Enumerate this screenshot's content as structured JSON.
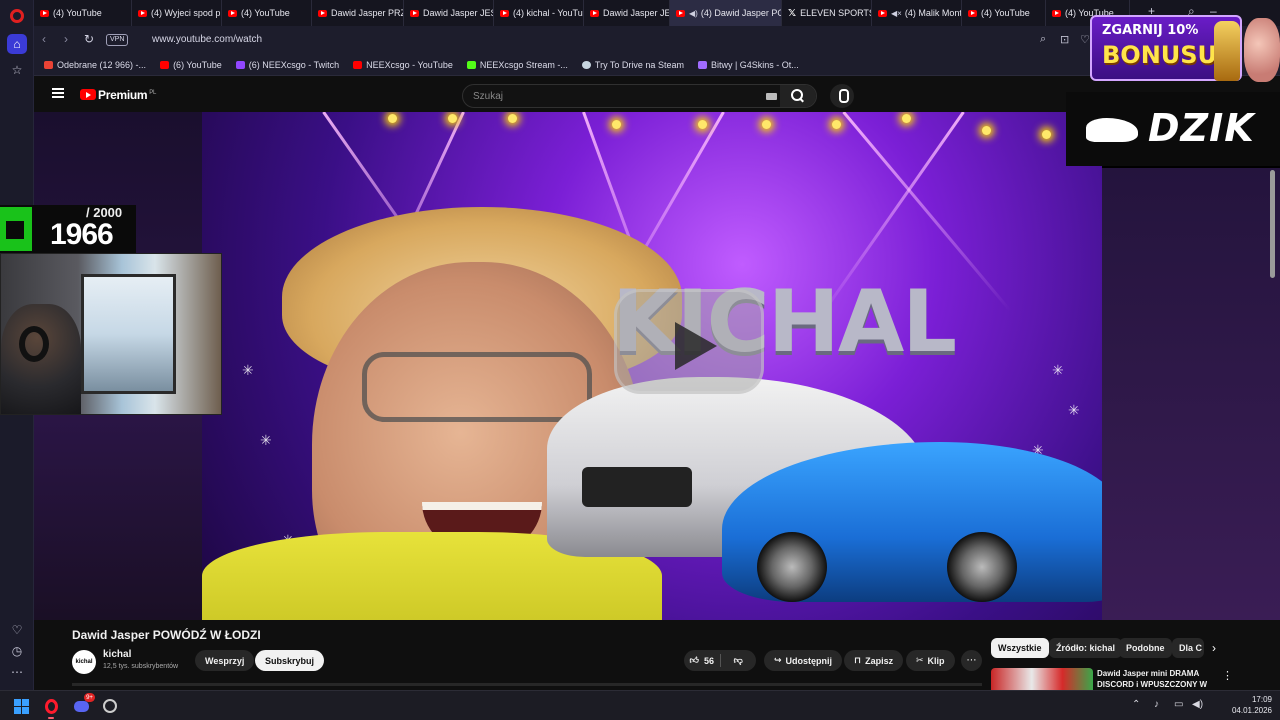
{
  "browser": {
    "tabs": [
      {
        "label": "(4) YouTube",
        "icon": "youtube-icon",
        "active": false
      },
      {
        "label": "(4) Wyjeci spod pra",
        "icon": "youtube-icon",
        "active": false
      },
      {
        "label": "(4) YouTube",
        "icon": "youtube-icon",
        "active": false
      },
      {
        "label": "Dawid Jasper PRZY",
        "icon": "youtube-icon",
        "active": false
      },
      {
        "label": "Dawid Jasper JEST",
        "icon": "youtube-icon",
        "active": false
      },
      {
        "label": "(4) kichal - YouTube",
        "icon": "youtube-icon",
        "active": false
      },
      {
        "label": "Dawid Jasper JEST",
        "icon": "youtube-icon",
        "active": false
      },
      {
        "label": "(4) Dawid Jasper POW",
        "icon": "youtube-icon",
        "active": true,
        "audio": true
      },
      {
        "label": "ELEVEN SPORTS PL",
        "icon": "x-icon",
        "active": false
      },
      {
        "label": "(4) Malik Monta",
        "icon": "youtube-icon",
        "active": false,
        "muted": true
      },
      {
        "label": "(4) YouTube",
        "icon": "youtube-icon",
        "active": false
      },
      {
        "label": "(4) YouTube",
        "icon": "youtube-icon",
        "active": false
      }
    ],
    "vpn_label": "VPN",
    "url": "www.youtube.com/watch",
    "bookmarks": [
      {
        "label": "Odebrane (12 966) -...",
        "color": "#ea4335"
      },
      {
        "label": "(6) YouTube",
        "color": "#ff0000"
      },
      {
        "label": "(6) NEEXcsgo - Twitch",
        "color": "#9146ff"
      },
      {
        "label": "NEEXcsgo - YouTube",
        "color": "#ff0000"
      },
      {
        "label": "NEEXcsgo Stream -...",
        "color": "#53fc18"
      },
      {
        "label": "Try To Drive na Steam",
        "color": "#c7d5e0"
      },
      {
        "label": "Bitwy | G4Skins - Ot...",
        "color": "#a06cff"
      }
    ]
  },
  "youtube": {
    "brand": "Premium",
    "brand_region": "PL",
    "search_placeholder": "Szukaj"
  },
  "video": {
    "overlay_text": "KICHAL",
    "counter_total": "/ 2000",
    "counter_value": "1966",
    "promo_line1": "ZGARNIJ 10%",
    "promo_line2": "BONUSU",
    "sponsor": "DZIK",
    "title": "Dawid Jasper POWÓDŹ W ŁODZI",
    "channel_name": "kichal",
    "channel_avatar_text": "kichal",
    "channel_subs": "12,5 tys. subskrybentów",
    "support_label": "Wesprzyj",
    "subscribe_label": "Subskrybuj",
    "like_count": "56",
    "share_label": "Udostępnij",
    "save_label": "Zapisz",
    "clip_label": "Klip"
  },
  "chips": [
    {
      "label": "Wszystkie",
      "selected": true
    },
    {
      "label": "Źródło: kichal",
      "selected": false
    },
    {
      "label": "Podobne",
      "selected": false
    },
    {
      "label": "Dla C",
      "selected": false
    }
  ],
  "recommendation": {
    "title": "Dawid Jasper mini DRAMA DISCORD i WPUSZCZONY W"
  },
  "taskbar": {
    "discord_badge": "9+",
    "time": "17:09",
    "date": "04.01.2026"
  }
}
